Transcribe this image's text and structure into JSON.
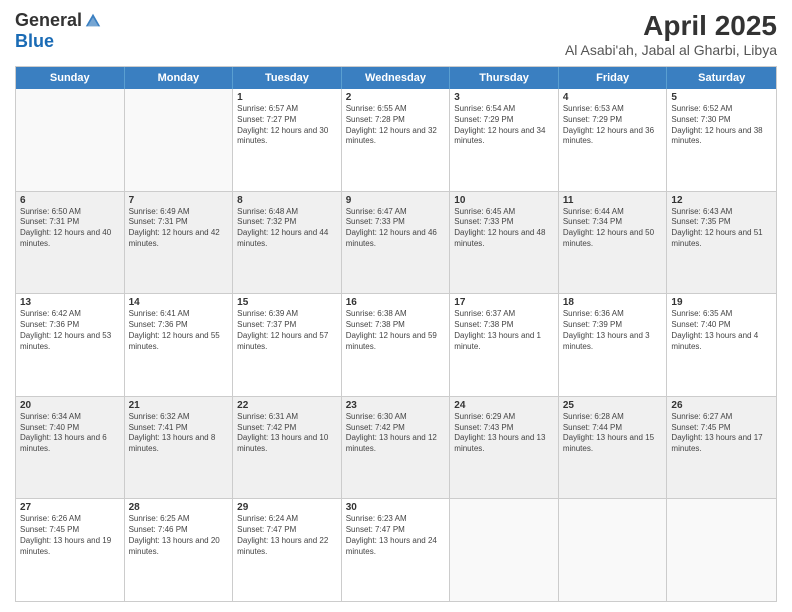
{
  "logo": {
    "general": "General",
    "blue": "Blue"
  },
  "title": "April 2025",
  "subtitle": "Al Asabi'ah, Jabal al Gharbi, Libya",
  "days": [
    "Sunday",
    "Monday",
    "Tuesday",
    "Wednesday",
    "Thursday",
    "Friday",
    "Saturday"
  ],
  "weeks": [
    [
      {
        "day": "",
        "info": ""
      },
      {
        "day": "",
        "info": ""
      },
      {
        "day": "1",
        "info": "Sunrise: 6:57 AM\nSunset: 7:27 PM\nDaylight: 12 hours and 30 minutes."
      },
      {
        "day": "2",
        "info": "Sunrise: 6:55 AM\nSunset: 7:28 PM\nDaylight: 12 hours and 32 minutes."
      },
      {
        "day": "3",
        "info": "Sunrise: 6:54 AM\nSunset: 7:29 PM\nDaylight: 12 hours and 34 minutes."
      },
      {
        "day": "4",
        "info": "Sunrise: 6:53 AM\nSunset: 7:29 PM\nDaylight: 12 hours and 36 minutes."
      },
      {
        "day": "5",
        "info": "Sunrise: 6:52 AM\nSunset: 7:30 PM\nDaylight: 12 hours and 38 minutes."
      }
    ],
    [
      {
        "day": "6",
        "info": "Sunrise: 6:50 AM\nSunset: 7:31 PM\nDaylight: 12 hours and 40 minutes."
      },
      {
        "day": "7",
        "info": "Sunrise: 6:49 AM\nSunset: 7:31 PM\nDaylight: 12 hours and 42 minutes."
      },
      {
        "day": "8",
        "info": "Sunrise: 6:48 AM\nSunset: 7:32 PM\nDaylight: 12 hours and 44 minutes."
      },
      {
        "day": "9",
        "info": "Sunrise: 6:47 AM\nSunset: 7:33 PM\nDaylight: 12 hours and 46 minutes."
      },
      {
        "day": "10",
        "info": "Sunrise: 6:45 AM\nSunset: 7:33 PM\nDaylight: 12 hours and 48 minutes."
      },
      {
        "day": "11",
        "info": "Sunrise: 6:44 AM\nSunset: 7:34 PM\nDaylight: 12 hours and 50 minutes."
      },
      {
        "day": "12",
        "info": "Sunrise: 6:43 AM\nSunset: 7:35 PM\nDaylight: 12 hours and 51 minutes."
      }
    ],
    [
      {
        "day": "13",
        "info": "Sunrise: 6:42 AM\nSunset: 7:36 PM\nDaylight: 12 hours and 53 minutes."
      },
      {
        "day": "14",
        "info": "Sunrise: 6:41 AM\nSunset: 7:36 PM\nDaylight: 12 hours and 55 minutes."
      },
      {
        "day": "15",
        "info": "Sunrise: 6:39 AM\nSunset: 7:37 PM\nDaylight: 12 hours and 57 minutes."
      },
      {
        "day": "16",
        "info": "Sunrise: 6:38 AM\nSunset: 7:38 PM\nDaylight: 12 hours and 59 minutes."
      },
      {
        "day": "17",
        "info": "Sunrise: 6:37 AM\nSunset: 7:38 PM\nDaylight: 13 hours and 1 minute."
      },
      {
        "day": "18",
        "info": "Sunrise: 6:36 AM\nSunset: 7:39 PM\nDaylight: 13 hours and 3 minutes."
      },
      {
        "day": "19",
        "info": "Sunrise: 6:35 AM\nSunset: 7:40 PM\nDaylight: 13 hours and 4 minutes."
      }
    ],
    [
      {
        "day": "20",
        "info": "Sunrise: 6:34 AM\nSunset: 7:40 PM\nDaylight: 13 hours and 6 minutes."
      },
      {
        "day": "21",
        "info": "Sunrise: 6:32 AM\nSunset: 7:41 PM\nDaylight: 13 hours and 8 minutes."
      },
      {
        "day": "22",
        "info": "Sunrise: 6:31 AM\nSunset: 7:42 PM\nDaylight: 13 hours and 10 minutes."
      },
      {
        "day": "23",
        "info": "Sunrise: 6:30 AM\nSunset: 7:42 PM\nDaylight: 13 hours and 12 minutes."
      },
      {
        "day": "24",
        "info": "Sunrise: 6:29 AM\nSunset: 7:43 PM\nDaylight: 13 hours and 13 minutes."
      },
      {
        "day": "25",
        "info": "Sunrise: 6:28 AM\nSunset: 7:44 PM\nDaylight: 13 hours and 15 minutes."
      },
      {
        "day": "26",
        "info": "Sunrise: 6:27 AM\nSunset: 7:45 PM\nDaylight: 13 hours and 17 minutes."
      }
    ],
    [
      {
        "day": "27",
        "info": "Sunrise: 6:26 AM\nSunset: 7:45 PM\nDaylight: 13 hours and 19 minutes."
      },
      {
        "day": "28",
        "info": "Sunrise: 6:25 AM\nSunset: 7:46 PM\nDaylight: 13 hours and 20 minutes."
      },
      {
        "day": "29",
        "info": "Sunrise: 6:24 AM\nSunset: 7:47 PM\nDaylight: 13 hours and 22 minutes."
      },
      {
        "day": "30",
        "info": "Sunrise: 6:23 AM\nSunset: 7:47 PM\nDaylight: 13 hours and 24 minutes."
      },
      {
        "day": "",
        "info": ""
      },
      {
        "day": "",
        "info": ""
      },
      {
        "day": "",
        "info": ""
      }
    ]
  ]
}
